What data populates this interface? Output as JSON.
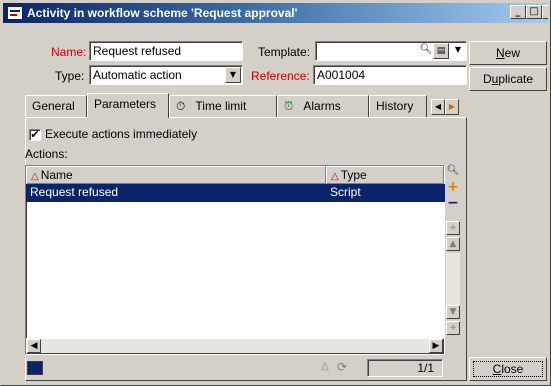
{
  "window": {
    "title": "Activity in workflow scheme 'Request approval'",
    "controls": {
      "minimize": "_",
      "maximize": "□",
      "close": "×"
    }
  },
  "form": {
    "name_label": "Name:",
    "name_value": "Request refused",
    "template_label": "Template:",
    "template_value": "",
    "type_label": "Type:",
    "type_value": "Automatic action",
    "reference_label": "Reference:",
    "reference_value": "A001004"
  },
  "side_buttons": {
    "new": "New",
    "duplicate": "Duplicate",
    "close": "Close"
  },
  "tabs": [
    {
      "label": "General"
    },
    {
      "label": "Parameters",
      "active": true
    },
    {
      "label": "Time limit"
    },
    {
      "label": "Alarms"
    },
    {
      "label": "History"
    }
  ],
  "parameters": {
    "execute_checkbox_label": "Execute actions immediately",
    "execute_checked": true,
    "actions_label": "Actions:",
    "columns": [
      "Name",
      "Type"
    ],
    "rows": [
      {
        "name": "Request refused",
        "type": "Script",
        "selected": true
      }
    ]
  },
  "status": {
    "record_counter": "1/1"
  },
  "icons": {
    "zoom": "magnifier-icon",
    "detail": "detail-icon",
    "add": "plus-icon",
    "remove": "minus-icon",
    "window_icon": "workflow-icon"
  },
  "colors": {
    "title_start": "#0a246a",
    "title_end": "#a6caf0",
    "selection": "#0a246a",
    "required_label": "#d00000",
    "face": "#d4d0c8"
  }
}
